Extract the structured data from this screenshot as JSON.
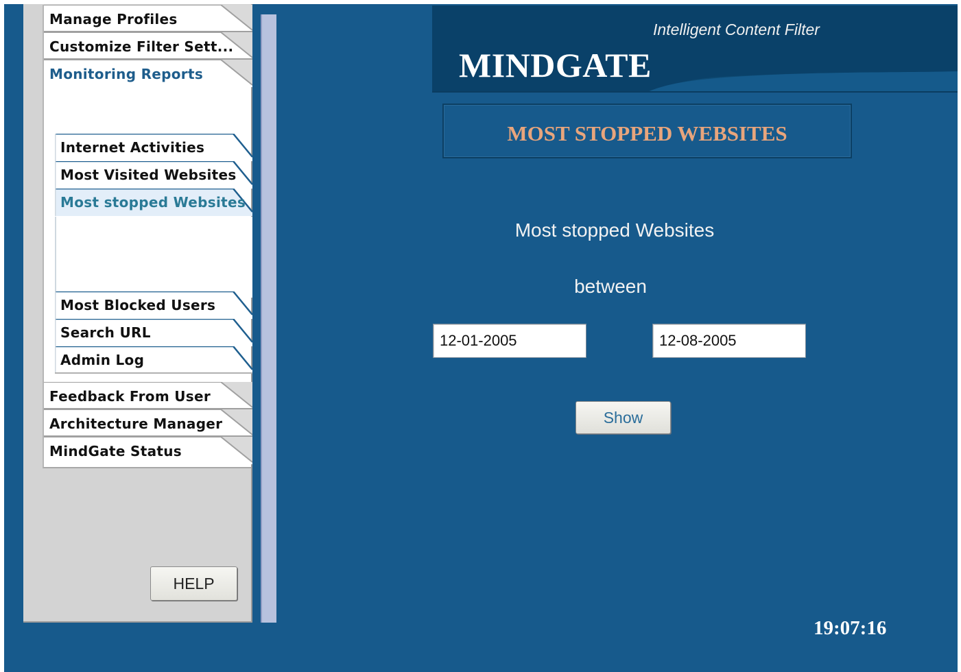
{
  "sidebar": {
    "tabs": [
      {
        "label": "Manage Profiles",
        "active": false
      },
      {
        "label": "Customize Filter Sett...",
        "active": false
      },
      {
        "label": "Monitoring Reports",
        "active": true
      }
    ],
    "subtabs": [
      {
        "label": "Internet Activities",
        "active": false
      },
      {
        "label": "Most Visited Websites",
        "active": false
      },
      {
        "label": "Most stopped Websites",
        "active": true
      },
      {
        "label": "Most Blocked Users",
        "active": false
      },
      {
        "label": "Search URL",
        "active": false
      },
      {
        "label": "Admin Log",
        "active": false
      }
    ],
    "lower_tabs": [
      {
        "label": "Feedback From User",
        "active": false
      },
      {
        "label": "Architecture Manager",
        "active": false
      },
      {
        "label": "MindGate Status",
        "active": false
      }
    ],
    "help_label": "HELP"
  },
  "header": {
    "tagline": "Intelligent Content Filter",
    "brand": "MINDGATE"
  },
  "main": {
    "page_title": "MOST STOPPED WEBSITES",
    "report_label": "Most stopped Websites",
    "between_label": "between",
    "start_date": "12-01-2005",
    "end_date": "12-08-2005",
    "show_label": "Show"
  },
  "status": {
    "clock": "19:07:16"
  },
  "colors": {
    "background": "#175a8c",
    "header": "#0e4a73",
    "title": "#e8a57c",
    "active_tab": "#1e5d8c",
    "active_subtab": "#2a7a96"
  }
}
